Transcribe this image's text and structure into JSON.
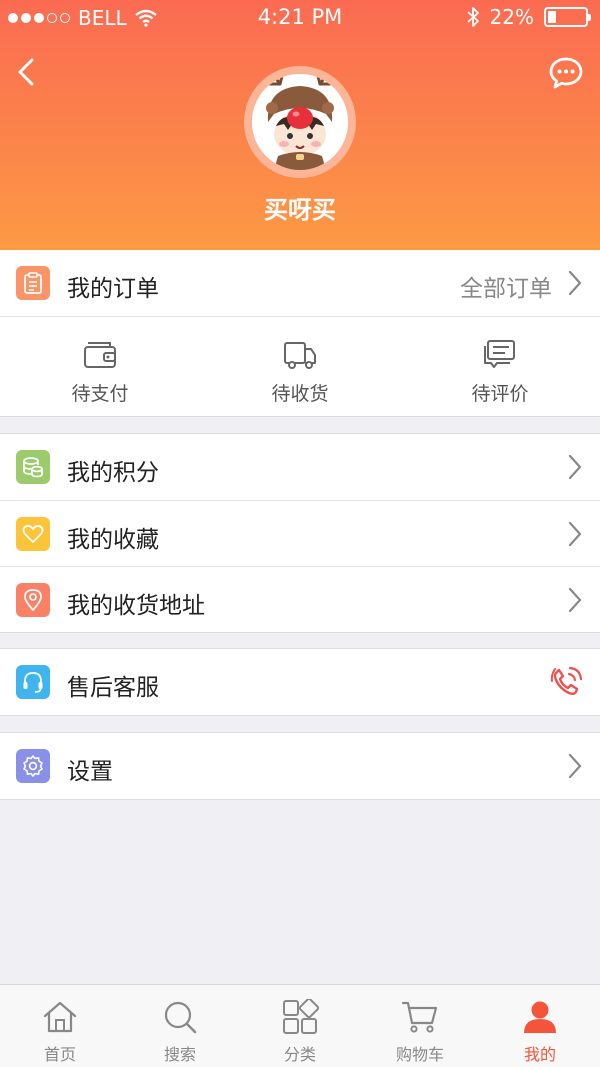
{
  "status_bar": {
    "carrier": "BELL",
    "time": "4:21 PM",
    "battery": "22%"
  },
  "profile": {
    "username": "买呀买"
  },
  "orders": {
    "title": "我的订单",
    "all_link": "全部订单",
    "sub": [
      {
        "label": "待支付",
        "icon": "wallet-icon"
      },
      {
        "label": "待收货",
        "icon": "truck-icon"
      },
      {
        "label": "待评价",
        "icon": "review-icon"
      }
    ]
  },
  "menu": {
    "points": "我的积分",
    "favorites": "我的收藏",
    "addresses": "我的收货地址",
    "service": "售后客服",
    "settings": "设置"
  },
  "tabbar": {
    "items": [
      {
        "label": "首页",
        "icon": "home-icon"
      },
      {
        "label": "搜索",
        "icon": "search-icon"
      },
      {
        "label": "分类",
        "icon": "category-icon"
      },
      {
        "label": "购物车",
        "icon": "cart-icon"
      },
      {
        "label": "我的",
        "icon": "user-icon"
      }
    ],
    "active_index": 4
  },
  "colors": {
    "header_top": "#fb6b52",
    "header_bottom": "#fc9a44",
    "accent": "#f4553a",
    "orders_icon": "#fb9467",
    "points_icon": "#9ccb6e",
    "favorites_icon": "#fcc43b",
    "addresses_icon": "#fb8166",
    "service_icon": "#3fb4ee",
    "settings_icon": "#8a90e8"
  }
}
